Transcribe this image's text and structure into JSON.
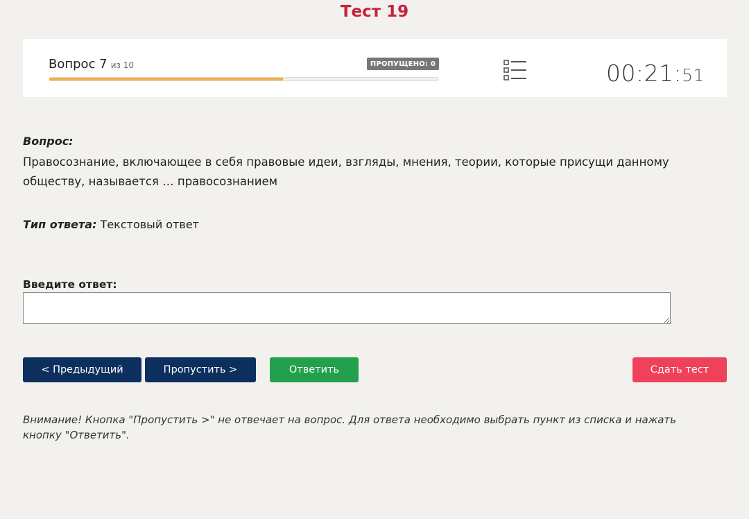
{
  "page": {
    "title": "Тест 19"
  },
  "progress": {
    "question_label": "Вопрос 7",
    "of_label": "из 10",
    "current": 7,
    "total": 10,
    "fill_fraction": 0.6,
    "skipped_badge": "ПРОПУЩЕНО: 0",
    "bar_color": "#f0b04b"
  },
  "timer": {
    "main": "00:21:",
    "seconds": "51"
  },
  "icons": {
    "question_list": "list-icon"
  },
  "question": {
    "heading": "Вопрос:",
    "text": "Правосознание, включающее в себя правовые идеи, взгляды, мнения, теории, которые присущи данному обществу, называется … правосознанием"
  },
  "answer_type": {
    "label": "Тип ответа:",
    "value": "Текстовый ответ"
  },
  "answer_input": {
    "label": "Введите ответ:",
    "value": ""
  },
  "buttons": {
    "prev": "< Предыдущий",
    "skip": "Пропустить >",
    "answer": "Ответить",
    "finish": "Сдать тест"
  },
  "notice": "Внимание! Кнопка \"Пропустить >\" не отвечает на вопрос. Для ответа необходимо выбрать пункт из списка и нажать кнопку \"Ответить\".",
  "colors": {
    "title": "#c8203a",
    "nav_button": "#0c2f5e",
    "answer_button": "#22a04b",
    "finish_button": "#f0415a"
  }
}
